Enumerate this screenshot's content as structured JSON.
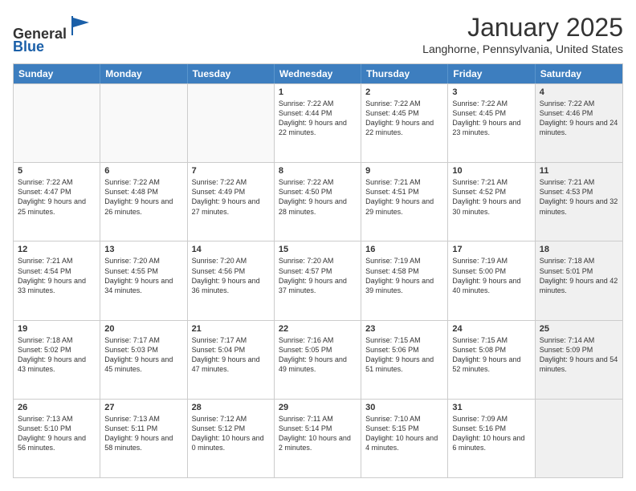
{
  "logo": {
    "general": "General",
    "blue": "Blue"
  },
  "title": "January 2025",
  "location": "Langhorne, Pennsylvania, United States",
  "days_of_week": [
    "Sunday",
    "Monday",
    "Tuesday",
    "Wednesday",
    "Thursday",
    "Friday",
    "Saturday"
  ],
  "weeks": [
    [
      {
        "num": "",
        "empty": true
      },
      {
        "num": "",
        "empty": true
      },
      {
        "num": "",
        "empty": true
      },
      {
        "num": "1",
        "sunrise": "7:22 AM",
        "sunset": "4:44 PM",
        "daylight": "9 hours and 22 minutes."
      },
      {
        "num": "2",
        "sunrise": "7:22 AM",
        "sunset": "4:45 PM",
        "daylight": "9 hours and 22 minutes."
      },
      {
        "num": "3",
        "sunrise": "7:22 AM",
        "sunset": "4:45 PM",
        "daylight": "9 hours and 23 minutes."
      },
      {
        "num": "4",
        "sunrise": "7:22 AM",
        "sunset": "4:46 PM",
        "daylight": "9 hours and 24 minutes.",
        "shaded": true
      }
    ],
    [
      {
        "num": "5",
        "sunrise": "7:22 AM",
        "sunset": "4:47 PM",
        "daylight": "9 hours and 25 minutes."
      },
      {
        "num": "6",
        "sunrise": "7:22 AM",
        "sunset": "4:48 PM",
        "daylight": "9 hours and 26 minutes."
      },
      {
        "num": "7",
        "sunrise": "7:22 AM",
        "sunset": "4:49 PM",
        "daylight": "9 hours and 27 minutes."
      },
      {
        "num": "8",
        "sunrise": "7:22 AM",
        "sunset": "4:50 PM",
        "daylight": "9 hours and 28 minutes."
      },
      {
        "num": "9",
        "sunrise": "7:21 AM",
        "sunset": "4:51 PM",
        "daylight": "9 hours and 29 minutes."
      },
      {
        "num": "10",
        "sunrise": "7:21 AM",
        "sunset": "4:52 PM",
        "daylight": "9 hours and 30 minutes."
      },
      {
        "num": "11",
        "sunrise": "7:21 AM",
        "sunset": "4:53 PM",
        "daylight": "9 hours and 32 minutes.",
        "shaded": true
      }
    ],
    [
      {
        "num": "12",
        "sunrise": "7:21 AM",
        "sunset": "4:54 PM",
        "daylight": "9 hours and 33 minutes."
      },
      {
        "num": "13",
        "sunrise": "7:20 AM",
        "sunset": "4:55 PM",
        "daylight": "9 hours and 34 minutes."
      },
      {
        "num": "14",
        "sunrise": "7:20 AM",
        "sunset": "4:56 PM",
        "daylight": "9 hours and 36 minutes."
      },
      {
        "num": "15",
        "sunrise": "7:20 AM",
        "sunset": "4:57 PM",
        "daylight": "9 hours and 37 minutes."
      },
      {
        "num": "16",
        "sunrise": "7:19 AM",
        "sunset": "4:58 PM",
        "daylight": "9 hours and 39 minutes."
      },
      {
        "num": "17",
        "sunrise": "7:19 AM",
        "sunset": "5:00 PM",
        "daylight": "9 hours and 40 minutes."
      },
      {
        "num": "18",
        "sunrise": "7:18 AM",
        "sunset": "5:01 PM",
        "daylight": "9 hours and 42 minutes.",
        "shaded": true
      }
    ],
    [
      {
        "num": "19",
        "sunrise": "7:18 AM",
        "sunset": "5:02 PM",
        "daylight": "9 hours and 43 minutes."
      },
      {
        "num": "20",
        "sunrise": "7:17 AM",
        "sunset": "5:03 PM",
        "daylight": "9 hours and 45 minutes."
      },
      {
        "num": "21",
        "sunrise": "7:17 AM",
        "sunset": "5:04 PM",
        "daylight": "9 hours and 47 minutes."
      },
      {
        "num": "22",
        "sunrise": "7:16 AM",
        "sunset": "5:05 PM",
        "daylight": "9 hours and 49 minutes."
      },
      {
        "num": "23",
        "sunrise": "7:15 AM",
        "sunset": "5:06 PM",
        "daylight": "9 hours and 51 minutes."
      },
      {
        "num": "24",
        "sunrise": "7:15 AM",
        "sunset": "5:08 PM",
        "daylight": "9 hours and 52 minutes."
      },
      {
        "num": "25",
        "sunrise": "7:14 AM",
        "sunset": "5:09 PM",
        "daylight": "9 hours and 54 minutes.",
        "shaded": true
      }
    ],
    [
      {
        "num": "26",
        "sunrise": "7:13 AM",
        "sunset": "5:10 PM",
        "daylight": "9 hours and 56 minutes."
      },
      {
        "num": "27",
        "sunrise": "7:13 AM",
        "sunset": "5:11 PM",
        "daylight": "9 hours and 58 minutes."
      },
      {
        "num": "28",
        "sunrise": "7:12 AM",
        "sunset": "5:12 PM",
        "daylight": "10 hours and 0 minutes."
      },
      {
        "num": "29",
        "sunrise": "7:11 AM",
        "sunset": "5:14 PM",
        "daylight": "10 hours and 2 minutes."
      },
      {
        "num": "30",
        "sunrise": "7:10 AM",
        "sunset": "5:15 PM",
        "daylight": "10 hours and 4 minutes."
      },
      {
        "num": "31",
        "sunrise": "7:09 AM",
        "sunset": "5:16 PM",
        "daylight": "10 hours and 6 minutes."
      },
      {
        "num": "",
        "empty": true,
        "shaded": true
      }
    ]
  ]
}
